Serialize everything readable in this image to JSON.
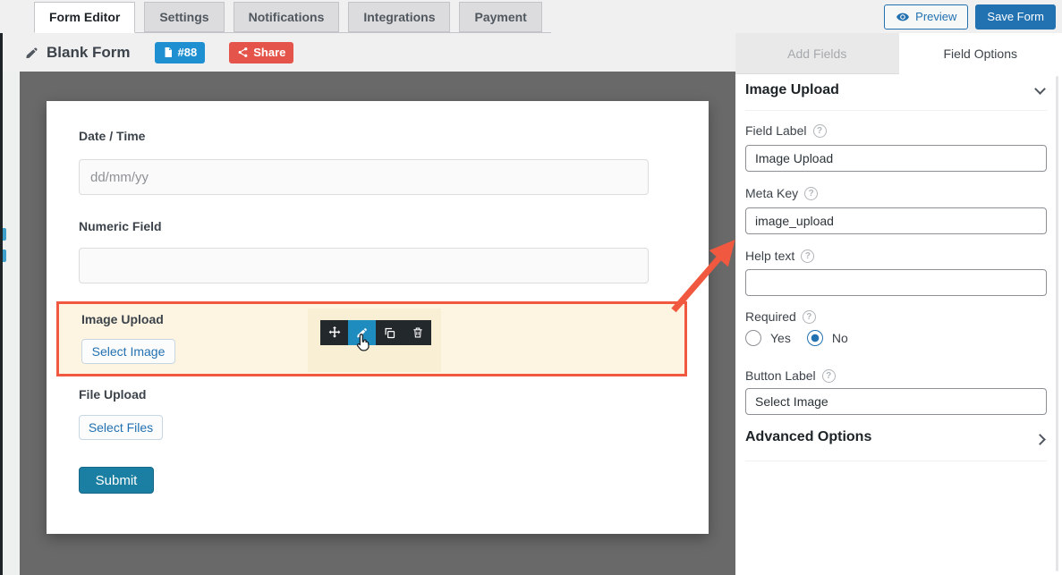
{
  "header": {
    "tabs": [
      {
        "label": "Form Editor",
        "active": true
      },
      {
        "label": "Settings",
        "active": false
      },
      {
        "label": "Notifications",
        "active": false
      },
      {
        "label": "Integrations",
        "active": false
      },
      {
        "label": "Payment",
        "active": false
      }
    ],
    "preview_label": "Preview",
    "save_label": "Save Form"
  },
  "form_bar": {
    "title": "Blank Form",
    "id_badge": "#88",
    "share_label": "Share"
  },
  "canvas": {
    "date_field": {
      "label": "Date / Time",
      "placeholder": "dd/mm/yy"
    },
    "numeric_field": {
      "label": "Numeric Field",
      "value": ""
    },
    "image_field": {
      "label": "Image Upload",
      "button_label": "Select Image",
      "selected": true
    },
    "file_field": {
      "label": "File Upload",
      "button_label": "Select Files"
    },
    "submit_label": "Submit"
  },
  "sidebar": {
    "tab_add_fields": "Add Fields",
    "tab_field_options": "Field Options",
    "section_title": "Image Upload",
    "field_label": {
      "label": "Field Label",
      "value": "Image Upload"
    },
    "meta_key": {
      "label": "Meta Key",
      "value": "image_upload"
    },
    "help_text": {
      "label": "Help text",
      "value": ""
    },
    "required": {
      "label": "Required",
      "yes_label": "Yes",
      "no_label": "No",
      "selected": "No"
    },
    "button_label": {
      "label": "Button Label",
      "value": "Select Image"
    },
    "advanced_options": "Advanced Options"
  },
  "icons": {
    "help_glyph": "?"
  },
  "colors": {
    "accent_blue": "#2271b1",
    "badge_blue": "#1e8fd0",
    "badge_red": "#e5544a",
    "highlight_border": "#f0593f",
    "highlight_bg": "#fdf5e2",
    "toolbar_bg": "#23282d",
    "toolbar_active_cell": "#1e8cbe",
    "submit_bg": "#1b7fa3",
    "canvas_bg": "#696969"
  }
}
